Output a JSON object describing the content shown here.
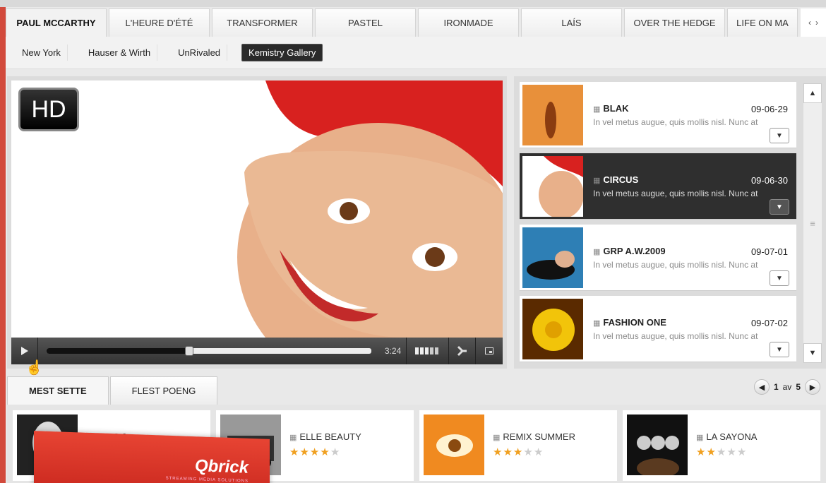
{
  "top_tabs": [
    {
      "label": "PAUL MCCARTHY",
      "active": true
    },
    {
      "label": "L'HEURE D'ÉTÉ"
    },
    {
      "label": "TRANSFORMER"
    },
    {
      "label": "PASTEL"
    },
    {
      "label": "IRONMADE"
    },
    {
      "label": "LAÍS"
    },
    {
      "label": "OVER THE HEDGE"
    },
    {
      "label": "LIFE ON MA"
    }
  ],
  "tab_arrows": {
    "prev": "‹",
    "next": "›"
  },
  "subnav": [
    {
      "label": "New York"
    },
    {
      "label": "Hauser & Wirth"
    },
    {
      "label": "UnRivaled"
    },
    {
      "label": "Kemistry Gallery",
      "active": true
    }
  ],
  "player": {
    "hd_label": "HD",
    "time": "3:24",
    "progress": 0.44
  },
  "playlist": [
    {
      "title": "BLAK",
      "date": "09-06-29",
      "desc": "In vel metus augue, quis mollis nisl. Nunc at"
    },
    {
      "title": "CIRCUS",
      "date": "09-06-30",
      "desc": "In vel metus augue, quis mollis nisl. Nunc at",
      "active": true
    },
    {
      "title": "GRP A.W.2009",
      "date": "09-07-01",
      "desc": "In vel metus augue, quis mollis nisl. Nunc at"
    },
    {
      "title": "FASHION ONE",
      "date": "09-07-02",
      "desc": "In vel metus augue, quis mollis nisl. Nunc at"
    }
  ],
  "bottom_tabs": [
    {
      "label": "MEST SETTE",
      "active": true
    },
    {
      "label": "FLEST POENG"
    }
  ],
  "pager": {
    "current": "1",
    "sep": "av",
    "total": "5"
  },
  "cards": [
    {
      "title": "MISC 2",
      "rating": 0
    },
    {
      "title": "ELLE BEAUTY",
      "rating": 4
    },
    {
      "title": "REMIX SUMMER",
      "rating": 3
    },
    {
      "title": "LA SAYONA",
      "rating": 2
    }
  ],
  "logo": {
    "text": "Qbrick",
    "sub": "STREAMING MEDIA SOLUTIONS"
  },
  "colors": {
    "brand": "#d24a3c",
    "star": "#f0a020",
    "active_item": "#2f2f2f"
  }
}
